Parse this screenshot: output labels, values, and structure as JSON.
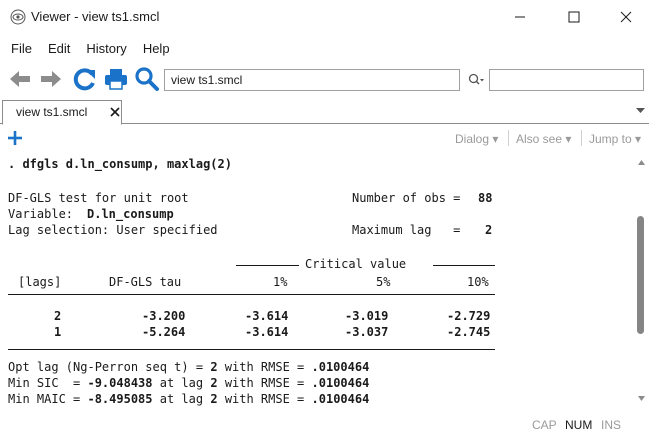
{
  "window": {
    "title": "Viewer - view ts1.smcl",
    "icon": "eye-icon",
    "controls": [
      "minimize-icon",
      "maximize-icon",
      "close-icon"
    ]
  },
  "menubar": {
    "items": [
      "File",
      "Edit",
      "History",
      "Help"
    ]
  },
  "toolbar": {
    "address_value": "view ts1.smcl",
    "search_value": "",
    "colors": {
      "nav": "#8c8c8c",
      "refresh": "#1a73c9",
      "search": "#1a73c9"
    }
  },
  "tabs": {
    "active_label": "view ts1.smcl"
  },
  "viewer_toolbar": {
    "dialog_label": "Dialog",
    "also_see_label": "Also see",
    "jump_to_label": "Jump to"
  },
  "results": {
    "command": ". dfgls d.ln_consump, maxlag(2)",
    "test_title": "DF-GLS test for unit root",
    "obs_label": "Number of obs =",
    "obs_value": "88",
    "variable_label": "Variable:",
    "variable_value": "D.ln_consump",
    "lag_selection": "Lag selection: User specified",
    "max_lag_label": "Maximum lag   =",
    "max_lag_value": "2",
    "critical_value_header": "Critical value",
    "columns": [
      "[lags]",
      "DF-GLS tau",
      "1%",
      "5%",
      "10%"
    ],
    "rows": [
      {
        "lags": "2",
        "tau": "-3.200",
        "c1": "-3.614",
        "c5": "-3.019",
        "c10": "-2.729"
      },
      {
        "lags": "1",
        "tau": "-5.264",
        "c1": "-3.614",
        "c5": "-3.037",
        "c10": "-2.745"
      }
    ],
    "opt_lag_prefix": "Opt lag (Ng-Perron seq t) =",
    "opt_lag_value": "2",
    "opt_lag_rmse_label": "with RMSE =",
    "opt_lag_rmse": ".0100464",
    "min_sic_prefix": "Min SIC  =",
    "min_sic_value": "-9.048438",
    "min_sic_lag_label": "at lag",
    "min_sic_lag": "2",
    "min_sic_rmse_label": "with RMSE =",
    "min_sic_rmse": ".0100464",
    "min_maic_prefix": "Min MAIC =",
    "min_maic_value": "-8.495085",
    "min_maic_lag_label": "at lag",
    "min_maic_lag": "2",
    "min_maic_rmse_label": "with RMSE =",
    "min_maic_rmse": ".0100464"
  },
  "status": {
    "cap": "CAP",
    "num": "NUM",
    "ins": "INS"
  }
}
